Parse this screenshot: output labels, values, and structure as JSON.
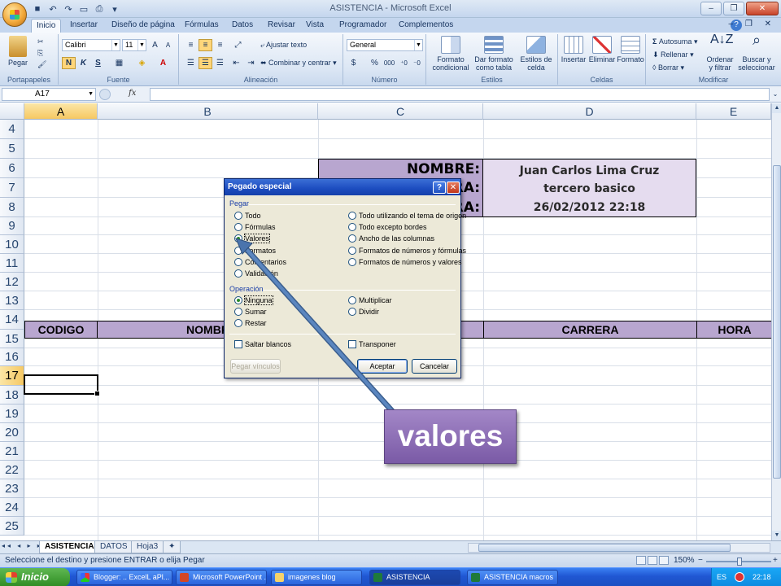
{
  "window": {
    "title": "ASISTENCIA - Microsoft Excel"
  },
  "ribbon": {
    "tabs": [
      "Inicio",
      "Insertar",
      "Diseño de página",
      "Fórmulas",
      "Datos",
      "Revisar",
      "Vista",
      "Programador",
      "Complementos"
    ],
    "groups": {
      "clipboard": {
        "label": "Portapapeles",
        "paste": "Pegar"
      },
      "font": {
        "label": "Fuente",
        "font_name": "Calibri",
        "font_size": "11"
      },
      "alignment": {
        "label": "Alineación",
        "wrap": "Ajustar texto",
        "merge": "Combinar y centrar"
      },
      "number": {
        "label": "Número",
        "format": "General"
      },
      "styles": {
        "label": "Estilos",
        "cond": "Formato condicional",
        "table": "Dar formato como tabla",
        "cell": "Estilos de celda"
      },
      "cells": {
        "label": "Celdas",
        "insert": "Insertar",
        "delete": "Eliminar",
        "format": "Formato"
      },
      "editing": {
        "label": "Modificar",
        "autosum": "Autosuma",
        "fill": "Rellenar",
        "clear": "Borrar",
        "sort": "Ordenar y filtrar",
        "find": "Buscar y seleccionar"
      }
    }
  },
  "formula_bar": {
    "name_box": "A17",
    "fx": "fx"
  },
  "columns": [
    "A",
    "B",
    "C",
    "D",
    "E"
  ],
  "rows": [
    "4",
    "5",
    "6",
    "7",
    "8",
    "9",
    "10",
    "11",
    "12",
    "13",
    "14",
    "15",
    "16",
    "17",
    "18",
    "19",
    "20",
    "21",
    "22",
    "23",
    "24",
    "25"
  ],
  "cells": {
    "labels": [
      "NOMBRE:",
      "RA:",
      "RA:"
    ],
    "values": [
      "Juan Carlos Lima Cruz",
      "tercero basico",
      "26/02/2012 22:18"
    ],
    "headers": [
      "CODIGO",
      "NOMBR",
      "CARRERA",
      "HORA"
    ]
  },
  "dialog": {
    "title": "Pegado especial",
    "paste_section": "Pegar",
    "paste_options_left": [
      "Todo",
      "Fórmulas",
      "Valores",
      "Formatos",
      "Comentarios",
      "Validación"
    ],
    "paste_options_right": [
      "Todo utilizando el tema de origen",
      "Todo excepto bordes",
      "Ancho de las columnas",
      "Formatos de números y fórmulas",
      "Formatos de números y valores"
    ],
    "selected_paste": "Valores",
    "operation_section": "Operación",
    "operation_left": [
      "Ninguna",
      "Sumar",
      "Restar"
    ],
    "operation_right": [
      "Multiplicar",
      "Dividir"
    ],
    "selected_operation": "Ninguna",
    "skip_blanks": "Saltar blancos",
    "transpose": "Transponer",
    "paste_link": "Pegar vínculos",
    "ok": "Aceptar",
    "cancel": "Cancelar"
  },
  "callout": {
    "text": "valores"
  },
  "sheets": [
    "ASISTENCIA",
    "DATOS",
    "Hoja3"
  ],
  "status": {
    "text": "Seleccione el destino y presione ENTRAR o elija Pegar",
    "zoom": "150%"
  },
  "taskbar": {
    "start": "Inicio",
    "items": [
      "Blogger: .. ExcelL aPl...",
      "Microsoft PowerPoint ...",
      "imagenes blog",
      "ASISTENCIA",
      "ASISTENCIA macros"
    ],
    "lang": "ES",
    "time": "22:18"
  }
}
